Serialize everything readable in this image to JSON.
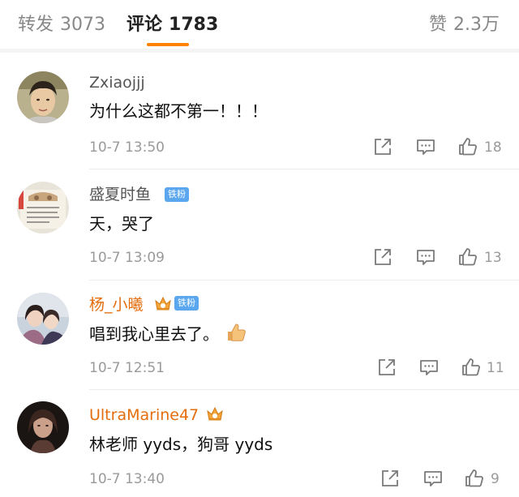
{
  "tabs": {
    "repost_label": "转发",
    "repost_count": "3073",
    "comment_label": "评论",
    "comment_count": "1783",
    "like_label": "赞",
    "like_count": "2.3万"
  },
  "comments": [
    {
      "username": "Zxiaojjj",
      "text": "为什么这都不第一！！！",
      "time": "10-7 13:50",
      "likes": "18"
    },
    {
      "username": "盛夏时鱼",
      "badge": "铁粉",
      "text": "天，哭了",
      "time": "10-7 13:09",
      "likes": "13"
    },
    {
      "username": "杨_小曦",
      "badge": "铁粉",
      "text": "唱到我心里去了。",
      "time": "10-7 12:51",
      "likes": "11"
    },
    {
      "username": "UltraMarine47",
      "text": "林老师 yyds，狗哥 yyds",
      "time": "10-7 13:40",
      "likes": "9"
    }
  ],
  "colors": {
    "accent": "#ff8200",
    "vip_name": "#e46d0e",
    "fan_badge": "#5aa7ef",
    "meta_text": "#9a9a9a"
  },
  "icons": [
    "share-icon",
    "reply-icon",
    "like-icon",
    "thumbs-up-emoji",
    "crown-icon"
  ]
}
